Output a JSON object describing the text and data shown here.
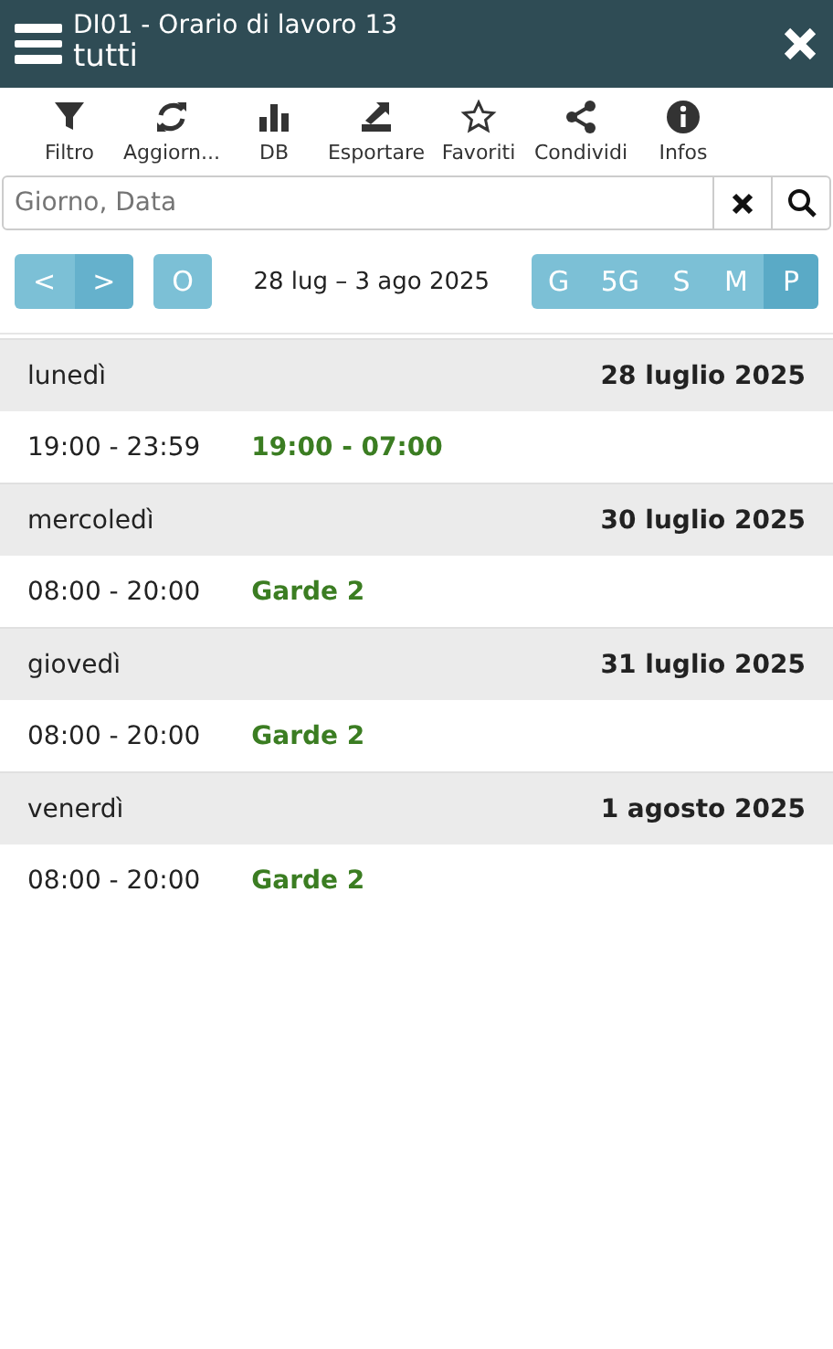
{
  "header": {
    "title": "DI01 - Orario di lavoro 13",
    "subtitle": "tutti"
  },
  "toolbar": [
    {
      "kind": "filter",
      "label": "Filtro"
    },
    {
      "kind": "refresh",
      "label": "Aggiorn..."
    },
    {
      "kind": "chart",
      "label": "DB"
    },
    {
      "kind": "export",
      "label": "Esportare"
    },
    {
      "kind": "star",
      "label": "Favoriti"
    },
    {
      "kind": "share",
      "label": "Condividi"
    },
    {
      "kind": "info",
      "label": "Infos"
    }
  ],
  "search": {
    "placeholder": "Giorno, Data"
  },
  "nav": {
    "prev": "<",
    "next": ">",
    "today": "O",
    "range": "28 lug – 3 ago 2025"
  },
  "views": [
    {
      "label": "G",
      "selected": false
    },
    {
      "label": "5G",
      "selected": false
    },
    {
      "label": "S",
      "selected": false
    },
    {
      "label": "M",
      "selected": false
    },
    {
      "label": "P",
      "selected": true
    }
  ],
  "days": [
    {
      "weekday": "lunedì",
      "date": "28 luglio 2025",
      "entries": [
        {
          "time": "19:00 - 23:59",
          "shift": "19:00 - 07:00"
        }
      ]
    },
    {
      "weekday": "mercoledì",
      "date": "30 luglio 2025",
      "entries": [
        {
          "time": "08:00 - 20:00",
          "shift": "Garde 2"
        }
      ]
    },
    {
      "weekday": "giovedì",
      "date": "31 luglio 2025",
      "entries": [
        {
          "time": "08:00 - 20:00",
          "shift": "Garde 2"
        }
      ]
    },
    {
      "weekday": "venerdì",
      "date": "1 agosto 2025",
      "entries": [
        {
          "time": "08:00 - 20:00",
          "shift": "Garde 2"
        }
      ]
    }
  ]
}
